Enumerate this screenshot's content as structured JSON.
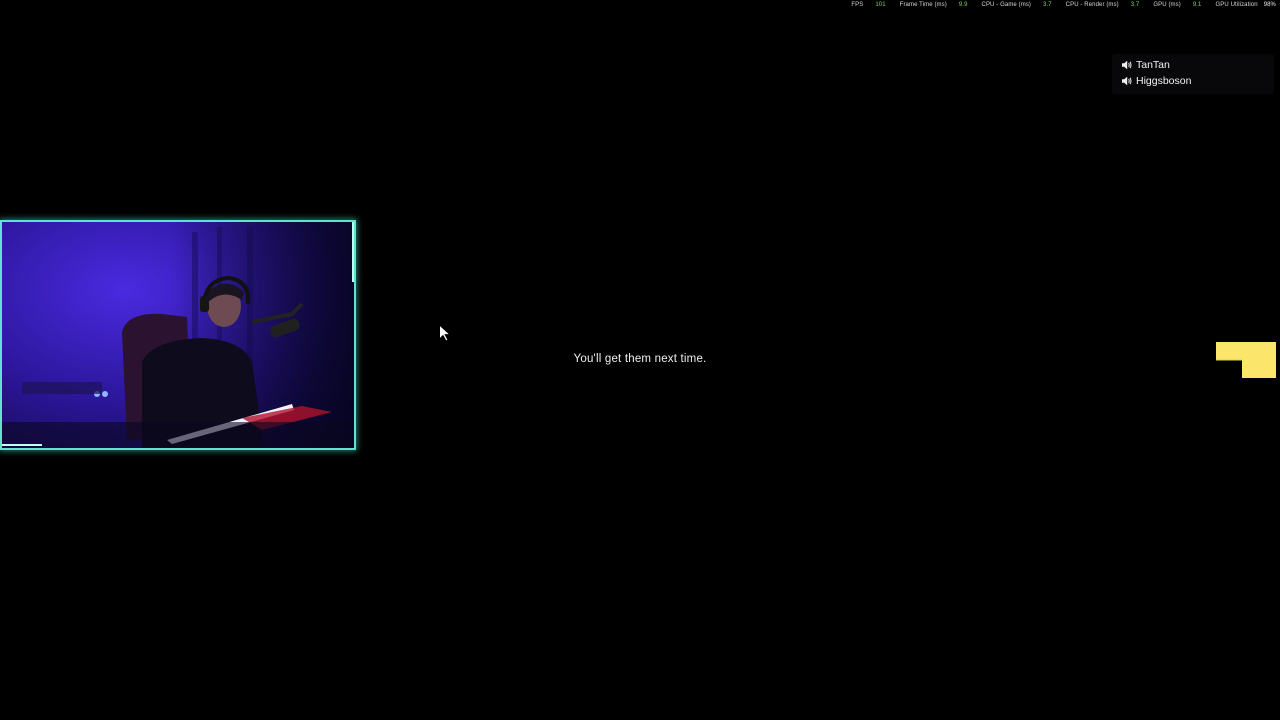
{
  "perf_overlay": {
    "fps": {
      "label": "FPS",
      "value": "101"
    },
    "frame_time": {
      "label": "Frame Time (ms)",
      "value": "9.9"
    },
    "cpu_game": {
      "label": "CPU - Game (ms)",
      "value": "3.7"
    },
    "cpu_render": {
      "label": "CPU - Render (ms)",
      "value": "3.7"
    },
    "gpu": {
      "label": "GPU (ms)",
      "value": "9.1"
    },
    "gpu_util": {
      "label": "GPU Utilization",
      "value": "98%"
    }
  },
  "voice_chat": {
    "players": [
      {
        "name": "TanTan",
        "icon": "speaker-icon"
      },
      {
        "name": "Higgsboson",
        "icon": "speaker-icon"
      }
    ]
  },
  "subtitle": "You'll get them next time.",
  "webcam": {
    "frame_color": "#5fe3d0",
    "background_color": "#3a1fc8"
  },
  "marker": {
    "color": "#fbe56a"
  }
}
